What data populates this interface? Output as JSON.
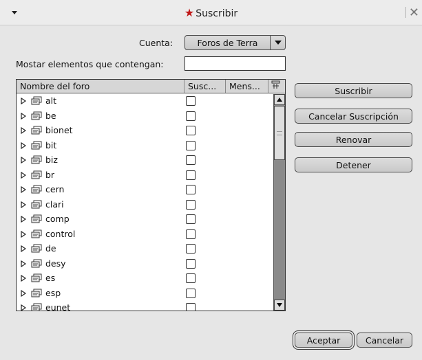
{
  "window": {
    "title": "Suscribir"
  },
  "account": {
    "label": "Cuenta:",
    "selected": "Foros de Terra"
  },
  "filter": {
    "label": "Mostar elementos que contengan:",
    "value": ""
  },
  "table": {
    "columns": [
      "Nombre del foro",
      "Susc...",
      "Mens..."
    ],
    "rows": [
      {
        "name": "alt",
        "subscribed": false
      },
      {
        "name": "be",
        "subscribed": false
      },
      {
        "name": "bionet",
        "subscribed": false
      },
      {
        "name": "bit",
        "subscribed": false
      },
      {
        "name": "biz",
        "subscribed": false
      },
      {
        "name": "br",
        "subscribed": false
      },
      {
        "name": "cern",
        "subscribed": false
      },
      {
        "name": "clari",
        "subscribed": false
      },
      {
        "name": "comp",
        "subscribed": false
      },
      {
        "name": "control",
        "subscribed": false
      },
      {
        "name": "de",
        "subscribed": false
      },
      {
        "name": "desy",
        "subscribed": false
      },
      {
        "name": "es",
        "subscribed": false
      },
      {
        "name": "esp",
        "subscribed": false
      },
      {
        "name": "eunet",
        "subscribed": false
      }
    ]
  },
  "actions": {
    "subscribe": "Suscribir",
    "cancel_subscription": "Cancelar Suscripción",
    "refresh": "Renovar",
    "stop": "Detener"
  },
  "footer": {
    "accept": "Aceptar",
    "cancel": "Cancelar"
  },
  "icons": {
    "window_menu": "triangle-down-icon",
    "app": "star-icon",
    "close": "close-icon",
    "newsgroup": "newsgroup-icon",
    "expander": "triangle-right-icon"
  },
  "colors": {
    "star": "#c01818",
    "background": "#e6e6e6"
  }
}
